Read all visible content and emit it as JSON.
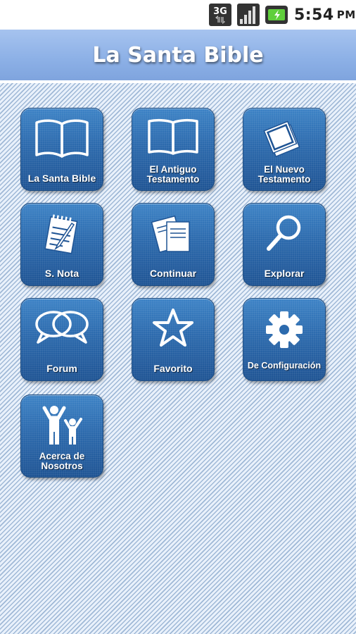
{
  "status_bar": {
    "network_label": "3G",
    "time": "5:54",
    "ampm": "PM",
    "icons": [
      "3g-icon",
      "signal-icon",
      "battery-icon"
    ]
  },
  "header": {
    "title": "La Santa Bible"
  },
  "theme": {
    "header_color": "#8cb0e6",
    "tile_color": "#2c6aad",
    "background_stripe": "#9fb8d6"
  },
  "menu": [
    {
      "label": "La Santa Bible",
      "icon": "open-book-icon"
    },
    {
      "label": "El Antiguo Testamento",
      "line1": "El Antiguo",
      "line2": "Testamento",
      "icon": "book-outline-icon"
    },
    {
      "label": "El Nuevo Testamento",
      "line1": "El Nuevo",
      "line2": "Testamento",
      "icon": "stacked-books-icon"
    },
    {
      "label": "S. Nota",
      "icon": "notepad-icon"
    },
    {
      "label": "Continuar",
      "icon": "documents-icon"
    },
    {
      "label": "Explorar",
      "icon": "search-icon"
    },
    {
      "label": "Forum",
      "icon": "chat-bubbles-icon"
    },
    {
      "label": "Favorito",
      "icon": "star-icon"
    },
    {
      "label": "De Configuración",
      "icon": "gear-icon"
    },
    {
      "label": "Acerca de Nosotros",
      "line1": "Acerca de",
      "line2": "Nosotros",
      "icon": "people-icon"
    }
  ]
}
